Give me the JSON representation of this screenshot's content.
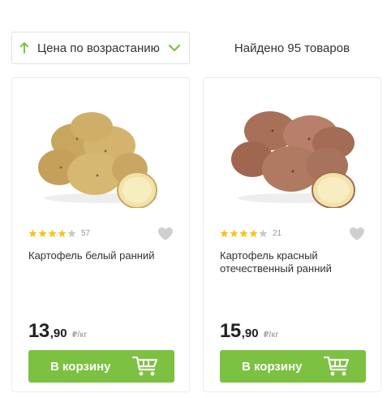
{
  "sort": {
    "label": "Цена по возрастанию",
    "icon": "arrow-up-icon",
    "chevron": "chevron-down-icon",
    "accent": "#7cc142"
  },
  "found_text": "Найдено 95 товаров",
  "products": [
    {
      "rating": 4,
      "rating_count": "57",
      "title": "Картофель белый ранний",
      "price_int": "13",
      "price_frac": ",90",
      "price_unit": "₽/кг",
      "button_label": "В корзину",
      "image": "white-potatoes"
    },
    {
      "rating": 4,
      "rating_count": "21",
      "title": "Картофель красный отечественный ранний",
      "price_int": "15",
      "price_frac": ",90",
      "price_unit": "₽/кг",
      "button_label": "В корзину",
      "image": "red-potatoes"
    }
  ],
  "colors": {
    "button": "#7cc142",
    "star_on": "#f5c518",
    "star_off": "#c8c8c8",
    "heart": "#cfcfcf"
  }
}
